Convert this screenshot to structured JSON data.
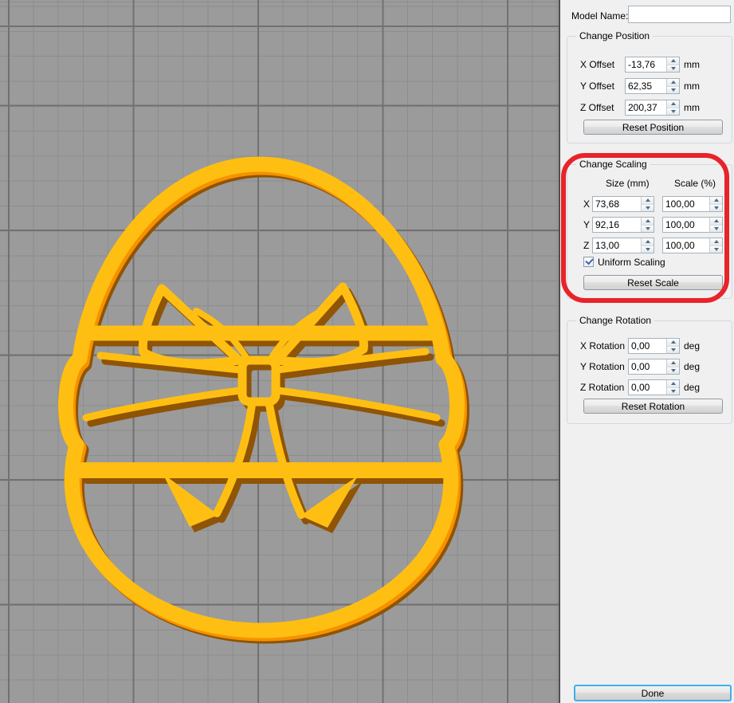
{
  "colors": {
    "viewport_bg": "#9b9b9b",
    "grid_minor": "#8d8d8d",
    "grid_major": "#717171",
    "model_yellow": "#ffbf12",
    "model_orange": "#f79100",
    "model_shadow": "#8f5405",
    "panel_bg": "#f0f0f0",
    "annotation_red": "#e8232a",
    "done_border": "#3fb0e8",
    "check_blue": "#3b67ad"
  },
  "viewport": {
    "model_description": "easter egg cookie cutter with bow ribbon, orange-yellow plastic"
  },
  "panel": {
    "model_name": {
      "label": "Model Name:",
      "value": ""
    },
    "position": {
      "title": "Change Position",
      "rows": [
        {
          "label": "X Offset",
          "value": "-13,76",
          "unit": "mm"
        },
        {
          "label": "Y Offset",
          "value": "62,35",
          "unit": "mm"
        },
        {
          "label": "Z Offset",
          "value": "200,37",
          "unit": "mm"
        }
      ],
      "reset_label": "Reset Position"
    },
    "scaling": {
      "title": "Change Scaling",
      "col_headers": [
        "Size (mm)",
        "Scale (%)"
      ],
      "rows": [
        {
          "label": "X",
          "size": "73,68",
          "scale": "100,00"
        },
        {
          "label": "Y",
          "size": "92,16",
          "scale": "100,00"
        },
        {
          "label": "Z",
          "size": "13,00",
          "scale": "100,00"
        }
      ],
      "uniform_label": "Uniform Scaling",
      "uniform_checked": true,
      "reset_label": "Reset Scale"
    },
    "rotation": {
      "title": "Change Rotation",
      "rows": [
        {
          "label": "X Rotation",
          "value": "0,00",
          "unit": "deg"
        },
        {
          "label": "Y Rotation",
          "value": "0,00",
          "unit": "deg"
        },
        {
          "label": "Z Rotation",
          "value": "0,00",
          "unit": "deg"
        }
      ],
      "reset_label": "Reset Rotation"
    },
    "done_label": "Done"
  }
}
